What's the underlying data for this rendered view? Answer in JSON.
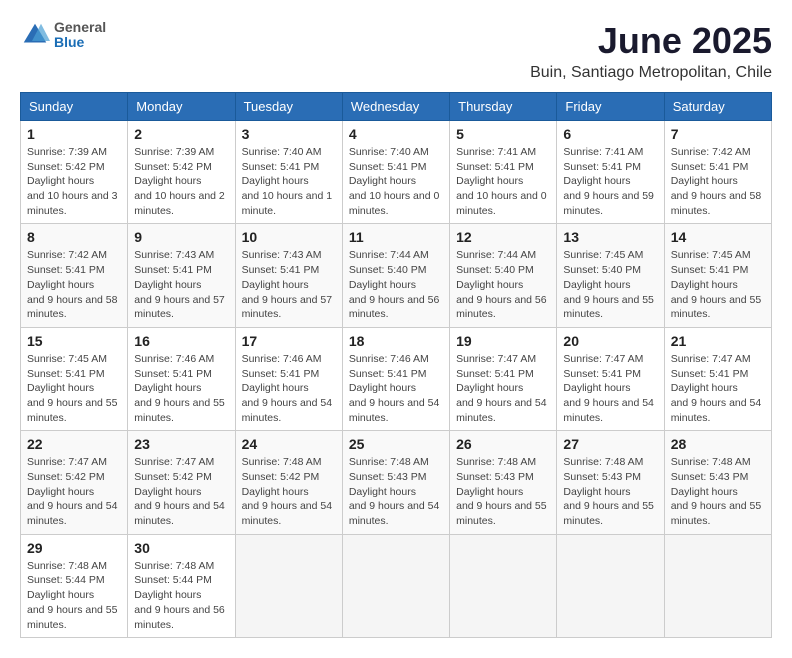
{
  "header": {
    "logo_general": "General",
    "logo_blue": "Blue",
    "month_title": "June 2025",
    "location": "Buin, Santiago Metropolitan, Chile"
  },
  "days_of_week": [
    "Sunday",
    "Monday",
    "Tuesday",
    "Wednesday",
    "Thursday",
    "Friday",
    "Saturday"
  ],
  "weeks": [
    [
      {
        "day": "1",
        "sunrise": "7:39 AM",
        "sunset": "5:42 PM",
        "daylight": "10 hours and 3 minutes."
      },
      {
        "day": "2",
        "sunrise": "7:39 AM",
        "sunset": "5:42 PM",
        "daylight": "10 hours and 2 minutes."
      },
      {
        "day": "3",
        "sunrise": "7:40 AM",
        "sunset": "5:41 PM",
        "daylight": "10 hours and 1 minute."
      },
      {
        "day": "4",
        "sunrise": "7:40 AM",
        "sunset": "5:41 PM",
        "daylight": "10 hours and 0 minutes."
      },
      {
        "day": "5",
        "sunrise": "7:41 AM",
        "sunset": "5:41 PM",
        "daylight": "10 hours and 0 minutes."
      },
      {
        "day": "6",
        "sunrise": "7:41 AM",
        "sunset": "5:41 PM",
        "daylight": "9 hours and 59 minutes."
      },
      {
        "day": "7",
        "sunrise": "7:42 AM",
        "sunset": "5:41 PM",
        "daylight": "9 hours and 58 minutes."
      }
    ],
    [
      {
        "day": "8",
        "sunrise": "7:42 AM",
        "sunset": "5:41 PM",
        "daylight": "9 hours and 58 minutes."
      },
      {
        "day": "9",
        "sunrise": "7:43 AM",
        "sunset": "5:41 PM",
        "daylight": "9 hours and 57 minutes."
      },
      {
        "day": "10",
        "sunrise": "7:43 AM",
        "sunset": "5:41 PM",
        "daylight": "9 hours and 57 minutes."
      },
      {
        "day": "11",
        "sunrise": "7:44 AM",
        "sunset": "5:40 PM",
        "daylight": "9 hours and 56 minutes."
      },
      {
        "day": "12",
        "sunrise": "7:44 AM",
        "sunset": "5:40 PM",
        "daylight": "9 hours and 56 minutes."
      },
      {
        "day": "13",
        "sunrise": "7:45 AM",
        "sunset": "5:40 PM",
        "daylight": "9 hours and 55 minutes."
      },
      {
        "day": "14",
        "sunrise": "7:45 AM",
        "sunset": "5:41 PM",
        "daylight": "9 hours and 55 minutes."
      }
    ],
    [
      {
        "day": "15",
        "sunrise": "7:45 AM",
        "sunset": "5:41 PM",
        "daylight": "9 hours and 55 minutes."
      },
      {
        "day": "16",
        "sunrise": "7:46 AM",
        "sunset": "5:41 PM",
        "daylight": "9 hours and 55 minutes."
      },
      {
        "day": "17",
        "sunrise": "7:46 AM",
        "sunset": "5:41 PM",
        "daylight": "9 hours and 54 minutes."
      },
      {
        "day": "18",
        "sunrise": "7:46 AM",
        "sunset": "5:41 PM",
        "daylight": "9 hours and 54 minutes."
      },
      {
        "day": "19",
        "sunrise": "7:47 AM",
        "sunset": "5:41 PM",
        "daylight": "9 hours and 54 minutes."
      },
      {
        "day": "20",
        "sunrise": "7:47 AM",
        "sunset": "5:41 PM",
        "daylight": "9 hours and 54 minutes."
      },
      {
        "day": "21",
        "sunrise": "7:47 AM",
        "sunset": "5:41 PM",
        "daylight": "9 hours and 54 minutes."
      }
    ],
    [
      {
        "day": "22",
        "sunrise": "7:47 AM",
        "sunset": "5:42 PM",
        "daylight": "9 hours and 54 minutes."
      },
      {
        "day": "23",
        "sunrise": "7:47 AM",
        "sunset": "5:42 PM",
        "daylight": "9 hours and 54 minutes."
      },
      {
        "day": "24",
        "sunrise": "7:48 AM",
        "sunset": "5:42 PM",
        "daylight": "9 hours and 54 minutes."
      },
      {
        "day": "25",
        "sunrise": "7:48 AM",
        "sunset": "5:43 PM",
        "daylight": "9 hours and 54 minutes."
      },
      {
        "day": "26",
        "sunrise": "7:48 AM",
        "sunset": "5:43 PM",
        "daylight": "9 hours and 55 minutes."
      },
      {
        "day": "27",
        "sunrise": "7:48 AM",
        "sunset": "5:43 PM",
        "daylight": "9 hours and 55 minutes."
      },
      {
        "day": "28",
        "sunrise": "7:48 AM",
        "sunset": "5:43 PM",
        "daylight": "9 hours and 55 minutes."
      }
    ],
    [
      {
        "day": "29",
        "sunrise": "7:48 AM",
        "sunset": "5:44 PM",
        "daylight": "9 hours and 55 minutes."
      },
      {
        "day": "30",
        "sunrise": "7:48 AM",
        "sunset": "5:44 PM",
        "daylight": "9 hours and 56 minutes."
      },
      null,
      null,
      null,
      null,
      null
    ]
  ]
}
